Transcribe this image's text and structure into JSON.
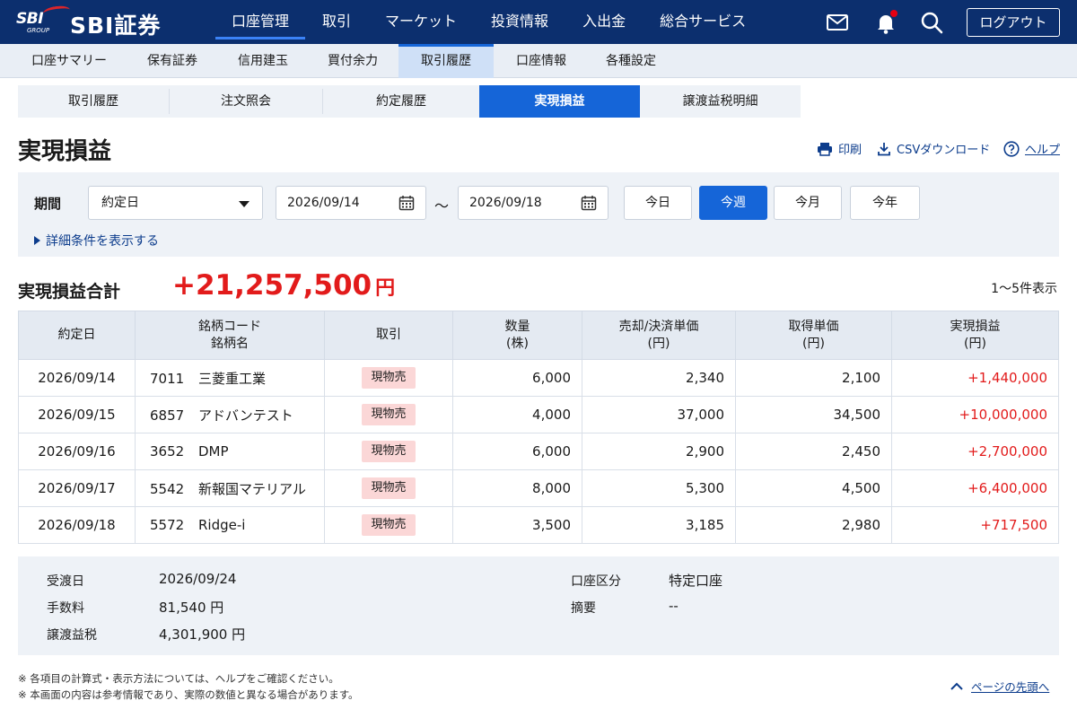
{
  "header": {
    "logo_mark": "SBI",
    "logo_group": "GROUP",
    "brand": "SBI証券",
    "nav": [
      "口座管理",
      "取引",
      "マーケット",
      "投資情報",
      "入出金",
      "総合サービス"
    ],
    "logout_label": "ログアウト",
    "icons": [
      "mail-icon",
      "bell-icon",
      "search-icon"
    ],
    "accent": "#0c2f6e"
  },
  "subnav": [
    "口座サマリー",
    "保有証券",
    "信用建玉",
    "買付余力",
    "取引履歴",
    "口座情報",
    "各種設定"
  ],
  "tabs": [
    "取引履歴",
    "注文照会",
    "約定履歴",
    "実現損益",
    "譲渡益税明細"
  ],
  "page": {
    "title": "実現損益",
    "print_label": "印刷",
    "csv_label": "CSVダウンロード",
    "help_label": "ヘルプ"
  },
  "filter": {
    "period_label": "期間",
    "date_type": "約定日",
    "from": "2026/09/14",
    "tilde": "〜",
    "to": "2026/09/18",
    "quick": [
      "今日",
      "今週",
      "今月",
      "今年"
    ],
    "detail_link": "詳細条件を表示する"
  },
  "total": {
    "label": "実現損益合計",
    "value": "+21,257,500",
    "unit": "円",
    "count": "1〜5件表示"
  },
  "table": {
    "headers": {
      "date": "約定日",
      "code": "銘柄コード",
      "name": "銘柄名",
      "type": "取引",
      "qty": "数量",
      "qty_unit": "(株)",
      "sell": "売却/決済単価",
      "sell_unit": "(円)",
      "cost": "取得単価",
      "cost_unit": "(円)",
      "pl": "実現損益",
      "pl_unit": "(円)"
    },
    "rows": [
      {
        "date": "2026/09/14",
        "code": "7011",
        "name": "三菱重工業",
        "type": "現物売",
        "qty": "6,000",
        "sell": "2,340",
        "cost": "2,100",
        "pl": "+1,440,000"
      },
      {
        "date": "2026/09/15",
        "code": "6857",
        "name": "アドバンテスト",
        "type": "現物売",
        "qty": "4,000",
        "sell": "37,000",
        "cost": "34,500",
        "pl": "+10,000,000"
      },
      {
        "date": "2026/09/16",
        "code": "3652",
        "name": "DMP",
        "type": "現物売",
        "qty": "6,000",
        "sell": "2,900",
        "cost": "2,450",
        "pl": "+2,700,000"
      },
      {
        "date": "2026/09/17",
        "code": "5542",
        "name": "新報国マテリアル",
        "type": "現物売",
        "qty": "8,000",
        "sell": "5,300",
        "cost": "4,500",
        "pl": "+6,400,000"
      },
      {
        "date": "2026/09/18",
        "code": "5572",
        "name": "Ridge-i",
        "type": "現物売",
        "qty": "3,500",
        "sell": "3,185",
        "cost": "2,980",
        "pl": "+717,500"
      }
    ]
  },
  "summary": {
    "settlement_label": "受渡日",
    "settlement_value": "2026/09/24",
    "fee_label": "手数料",
    "fee_value": "81,540 円",
    "tax_label": "譲渡益税",
    "tax_value": "4,301,900 円",
    "account_label": "口座区分",
    "account_value": "特定口座",
    "memo_label": "摘要",
    "memo_value": "--"
  },
  "notes": [
    "※ 各項目の計算式・表示方法については、ヘルプをご確認ください。",
    "※ 本画面の内容は参考情報であり、実際の数値と異なる場合があります。"
  ],
  "page_top": "ページの先頭へ",
  "colors": {
    "primary": "#1565d8",
    "profit": "#e21b1b",
    "badge_bg": "#fbd7d7"
  }
}
